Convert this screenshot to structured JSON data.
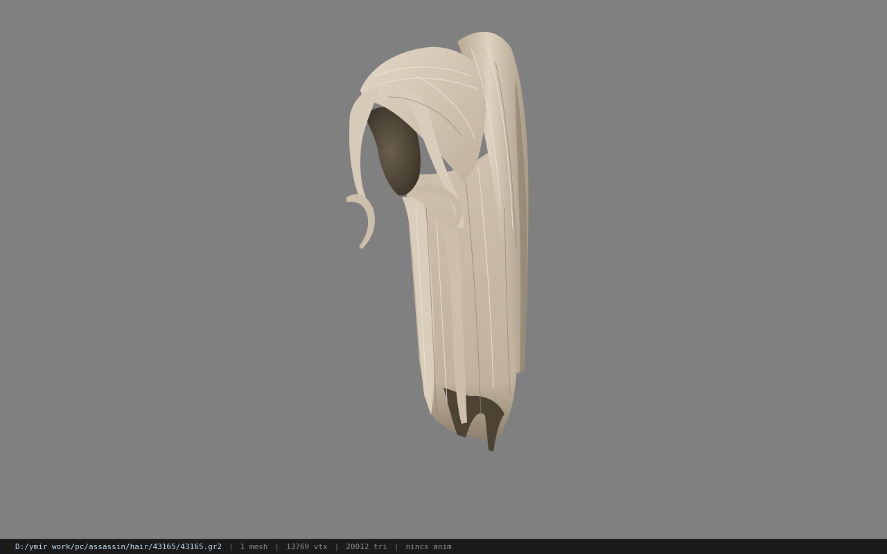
{
  "viewport": {
    "background_color": "#808080",
    "model": {
      "description_icon": "hair-mesh-render",
      "colors": {
        "hair_light": "#dcd0be",
        "hair_mid": "#c6b8a3",
        "hair_shadow": "#8f8370",
        "scalp_dark": "#514737"
      }
    }
  },
  "statusbar": {
    "file_path": "D:/ymir work/pc/assassin/hair/43165/43165.gr2",
    "separator": "|",
    "mesh_count": "1 mesh",
    "vertex_count": "13769 vtx",
    "triangle_count": "20012 tri",
    "anim_status": "nincs anim"
  }
}
